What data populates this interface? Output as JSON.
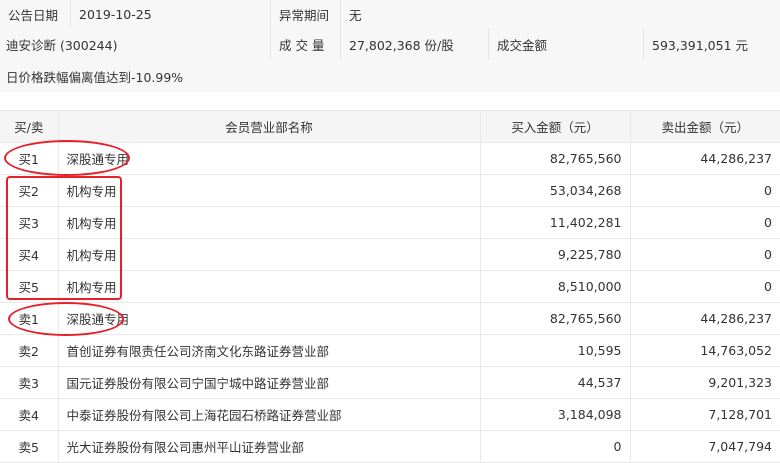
{
  "info": {
    "row1": {
      "date_label": "公告日期",
      "date_value": "2019-10-25",
      "period_label": "异常期间",
      "period_value": "无"
    },
    "row2": {
      "stock_name": "迪安诊断 (300244)",
      "volume_label": "成 交 量",
      "volume_value": "27,802,368 份/股",
      "amount_label": "成交金额",
      "amount_value": "593,391,051 元"
    },
    "row3": {
      "reason": "日价格跌幅偏离值达到-10.99%"
    }
  },
  "table": {
    "headers": {
      "side": "买/卖",
      "name": "会员营业部名称",
      "buy": "买入金额（元）",
      "sell": "卖出金额（元）"
    },
    "rows": [
      {
        "side": "买1",
        "name": "深股通专用",
        "buy": "82,765,560",
        "sell": "44,286,237"
      },
      {
        "side": "买2",
        "name": "机构专用",
        "buy": "53,034,268",
        "sell": "0"
      },
      {
        "side": "买3",
        "name": "机构专用",
        "buy": "11,402,281",
        "sell": "0"
      },
      {
        "side": "买4",
        "name": "机构专用",
        "buy": "9,225,780",
        "sell": "0"
      },
      {
        "side": "买5",
        "name": "机构专用",
        "buy": "8,510,000",
        "sell": "0"
      },
      {
        "side": "卖1",
        "name": "深股通专用",
        "buy": "82,765,560",
        "sell": "44,286,237"
      },
      {
        "side": "卖2",
        "name": "首创证券有限责任公司济南文化东路证券营业部",
        "buy": "10,595",
        "sell": "14,763,052"
      },
      {
        "side": "卖3",
        "name": "国元证券股份有限公司宁国宁城中路证券营业部",
        "buy": "44,537",
        "sell": "9,201,323"
      },
      {
        "side": "卖4",
        "name": "中泰证券股份有限公司上海花园石桥路证券营业部",
        "buy": "3,184,098",
        "sell": "7,128,701"
      },
      {
        "side": "卖5",
        "name": "光大证券股份有限公司惠州平山证券营业部",
        "buy": "0",
        "sell": "7,047,794"
      }
    ]
  },
  "annotation_color": "#e8202a"
}
